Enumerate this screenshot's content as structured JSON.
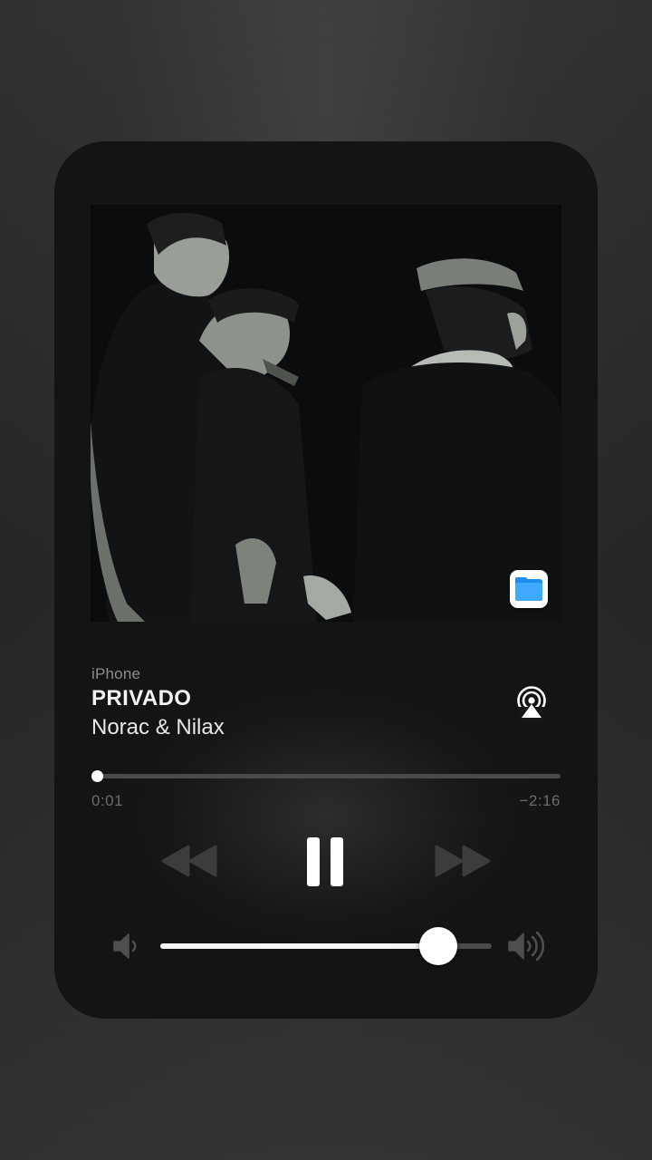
{
  "player": {
    "source": "iPhone",
    "title": "PRIVADO",
    "artist": "Norac & Nilax",
    "elapsed": "0:01",
    "remaining": "−2:16",
    "progress": 0.006,
    "volume": 0.84,
    "state": "playing"
  },
  "icons": {
    "artwork_badge": "files-app-icon",
    "airplay": "airplay-audio-icon",
    "rewind": "rewind-icon",
    "play_pause": "pause-icon",
    "forward": "fast-forward-icon",
    "volume_low": "volume-low-icon",
    "volume_high": "volume-high-icon"
  },
  "colors": {
    "card": "#141414",
    "accent": "#ffffff",
    "dim_control": "#3c3c3e",
    "secondary_text": "#8d8d8f",
    "files_blue": "#1c8cf0"
  }
}
